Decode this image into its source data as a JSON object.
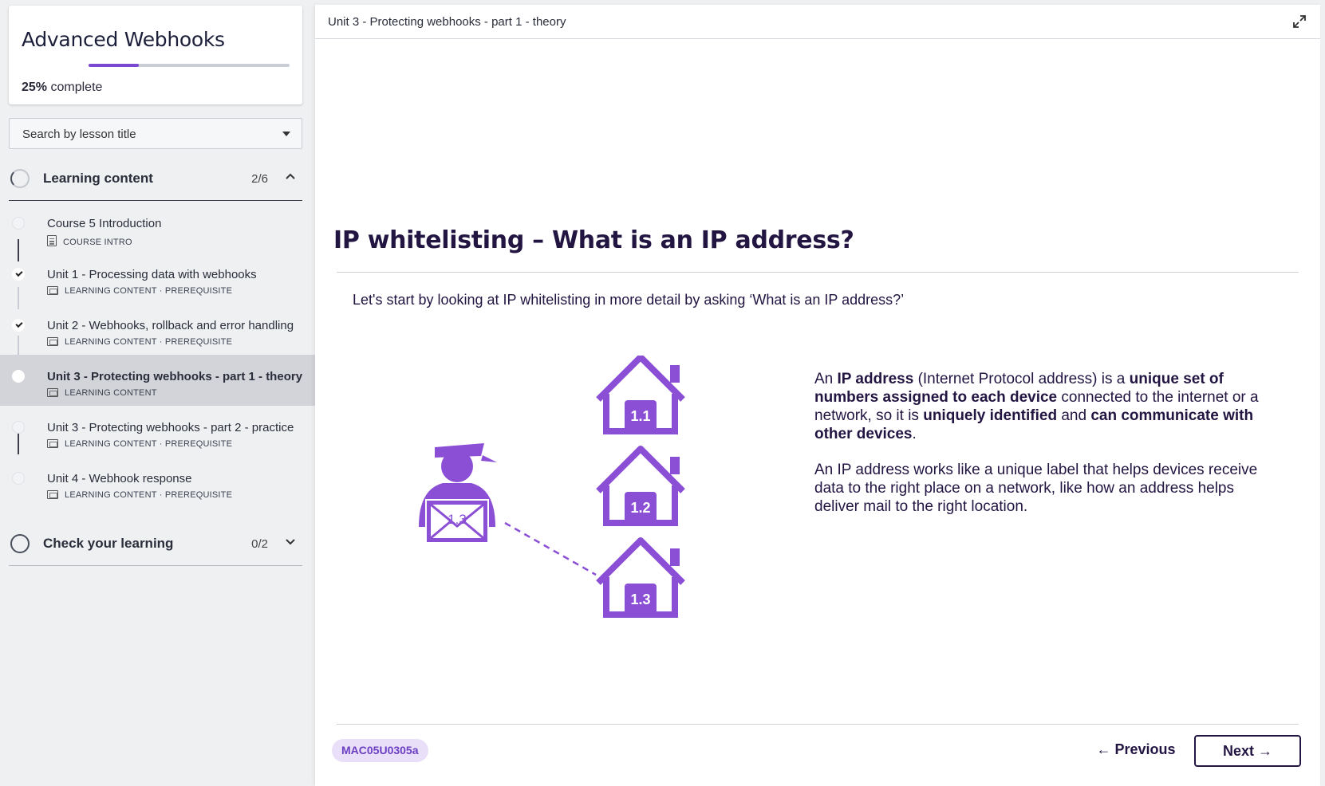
{
  "sidebar": {
    "course_title": "Advanced Webhooks",
    "progress_percent": "25%",
    "progress_fraction": 0.25,
    "progress_suffix": "complete",
    "search_placeholder": "Search by lesson title",
    "sections": [
      {
        "title": "Learning content",
        "count": "2/6",
        "expanded": true
      },
      {
        "title": "Check your learning",
        "count": "0/2",
        "expanded": false
      }
    ],
    "lessons": [
      {
        "name": "Course 5 Introduction",
        "meta": "COURSE INTRO",
        "status": "none",
        "icon": "document-icon"
      },
      {
        "name": "Unit 1 - Processing data with webhooks",
        "meta": "LEARNING CONTENT · PREREQUISITE",
        "status": "done",
        "icon": "slides-icon"
      },
      {
        "name": "Unit 2 - Webhooks, rollback and error handling",
        "meta": "LEARNING CONTENT · PREREQUISITE",
        "status": "done",
        "icon": "slides-icon"
      },
      {
        "name": "Unit 3 - Protecting webhooks - part 1 - theory",
        "meta": "LEARNING CONTENT",
        "status": "current",
        "icon": "slides-icon"
      },
      {
        "name": "Unit 3 - Protecting webhooks - part 2 - practice",
        "meta": "LEARNING CONTENT · PREREQUISITE",
        "status": "none",
        "icon": "slides-icon"
      },
      {
        "name": "Unit 4 - Webhook response",
        "meta": "LEARNING CONTENT · PREREQUISITE",
        "status": "none",
        "icon": "slides-icon"
      }
    ]
  },
  "main": {
    "breadcrumb": "Unit 3 - Protecting webhooks - part 1 - theory",
    "heading": "IP whitelisting – What is an IP address?",
    "intro": "Let's start by looking at IP whitelisting in more detail by asking ‘What is an IP address?’",
    "illustration": {
      "envelope_label": "1.3",
      "houses": [
        "1.1",
        "1.2",
        "1.3"
      ]
    },
    "paragraph1": {
      "t1": "An ",
      "b1": "IP address",
      "t2": " (Internet Protocol address) is a ",
      "b2": "unique set of numbers assigned to each device",
      "t3": " connected to the internet or a network, so it is ",
      "b3": "uniquely identified",
      "t4": " and ",
      "b4": "can communicate with other devices",
      "t5": "."
    },
    "paragraph2": "An IP address works like a unique label that helps devices receive data to the right place on a network, like how an address helps deliver mail to the right location.",
    "code": "MAC05U0305a",
    "prev_label": "← Previous",
    "next_label": "Next →"
  },
  "colors": {
    "accent": "#8b4fd6",
    "ink": "#231542"
  }
}
